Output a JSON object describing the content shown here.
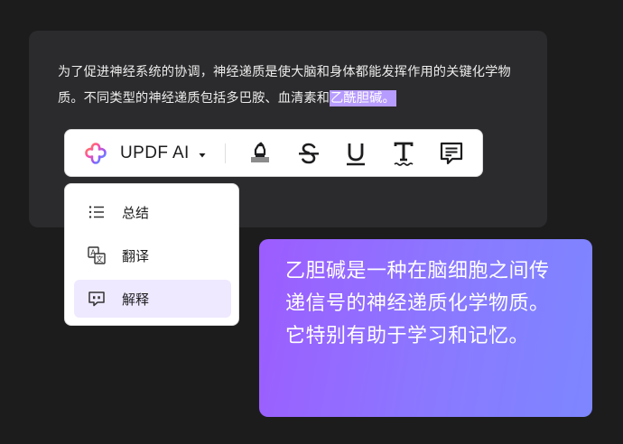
{
  "document": {
    "paragraph_before_highlight": "为了促进神经系统的协调，神经递质是使大脑和身体都能发挥作用的关键化学物质。不同类型的神经递质包括多巴胺、血清素和",
    "highlighted_text": "乙酰胆碱。"
  },
  "toolbar": {
    "brand_label": "UPDF AI",
    "logo_icon": "updf-ai-logo-icon",
    "items": [
      {
        "icon": "highlighter-icon",
        "color": "#1d1d1f"
      },
      {
        "icon": "strikethrough-icon",
        "color": "#1d1d1f"
      },
      {
        "icon": "underline-icon",
        "color": "#1d1d1f"
      },
      {
        "icon": "squiggly-text-icon",
        "color": "#1d1d1f"
      },
      {
        "icon": "comment-icon",
        "color": "#1d1d1f"
      }
    ]
  },
  "menu": {
    "items": [
      {
        "label": "总结",
        "icon": "list-icon",
        "active": false
      },
      {
        "label": "翻译",
        "icon": "translate-icon",
        "active": false
      },
      {
        "label": "解释",
        "icon": "explain-chat-icon",
        "active": true
      }
    ]
  },
  "answer": {
    "text": "乙胆碱是一种在脑细胞之间传递信号的神经递质化学物质。它特别有助于学习和记忆。"
  },
  "colors": {
    "background": "#1c1c1d",
    "document_card": "#2b2b2d",
    "highlight": "#b79cff",
    "menu_active": "#efe9ff",
    "answer_gradient_start": "#9d5cff",
    "answer_gradient_end": "#7d86ff"
  }
}
